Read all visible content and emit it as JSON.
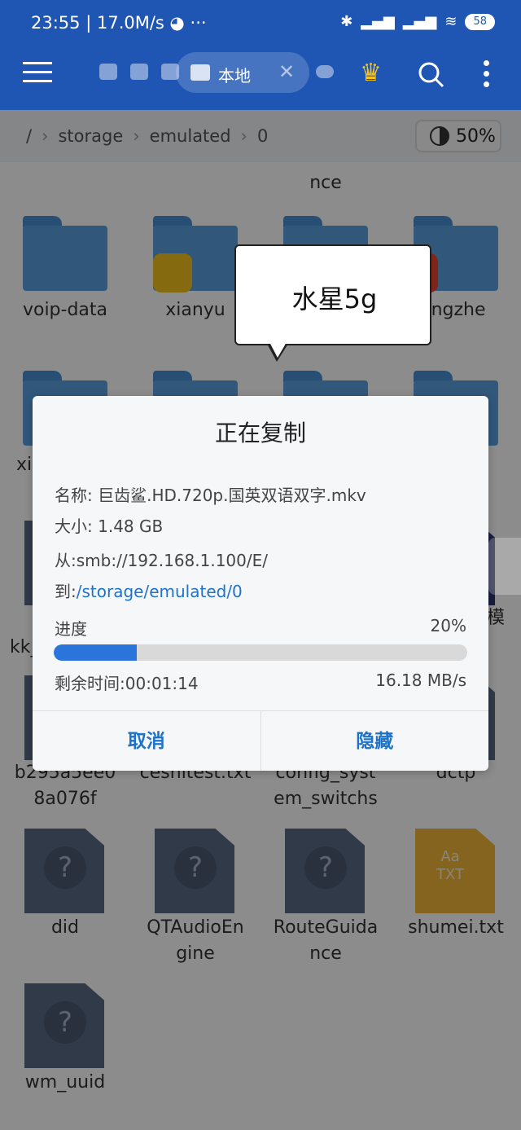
{
  "status_bar": {
    "time": "23:55",
    "speed": "17.0M/s",
    "battery": "58"
  },
  "toolbar": {
    "location_chip": "本地"
  },
  "breadcrumb": {
    "root": "/",
    "items": [
      "storage",
      "emulated",
      "0"
    ],
    "storage_usage": "50%"
  },
  "files": {
    "top_partial": [
      "nce"
    ],
    "row1": [
      "voip-data",
      "xianyu",
      "",
      "ingzhe"
    ],
    "row_mid_left": "xi",
    "row_mid_left2": "kk_",
    "row_mid_right": "模",
    "row3_line1": [
      "b295a5ee0",
      "ceshitest.txt",
      "config_syst",
      "dctp"
    ],
    "row3_line2": [
      "8a076f",
      "",
      "em_switchs",
      ""
    ],
    "row4_line1": [
      "did",
      "QTAudioEn",
      "RouteGuida",
      "shumei.txt"
    ],
    "row4_line2": [
      "",
      "gine",
      "nce",
      ""
    ],
    "row5": [
      "wm_uuid"
    ],
    "txt_icon": "Aa\nTXT"
  },
  "bubble": {
    "text": "水星5g"
  },
  "dialog": {
    "title": "正在复制",
    "name_label": "名称: ",
    "name_value": "巨齿鲨.HD.720p.国英双语双字.mkv",
    "size_label": "大小: ",
    "size_value": "1.48 GB",
    "from_label": "从:",
    "from_value": "smb://192.168.1.100/E/",
    "to_label": "到:",
    "to_value": "/storage/emulated/0",
    "progress_label": "进度",
    "progress_percent": "20%",
    "progress_value": 0.2,
    "remaining_label": "剩余时间:",
    "remaining_value": "00:01:14",
    "speed": "16.18 MB/s",
    "cancel": "取消",
    "hide": "隐藏"
  },
  "colors": {
    "brand": "#1f56b3",
    "accent": "#1e73c8",
    "progress": "#2b74dc"
  }
}
